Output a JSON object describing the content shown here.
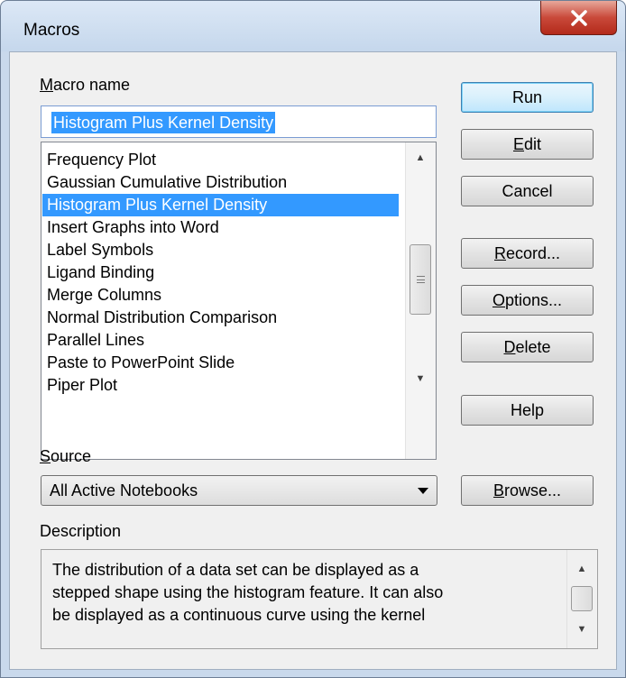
{
  "window": {
    "title": "Macros"
  },
  "macro_name": {
    "label_prefix": "",
    "label_mnemonic": "M",
    "label_rest": "acro name",
    "value": "Histogram Plus Kernel Density"
  },
  "macro_list": {
    "items": [
      "Frequency Plot",
      "Gaussian Cumulative Distribution",
      "Histogram Plus Kernel Density",
      "Insert Graphs into Word",
      "Label Symbols",
      "Ligand Binding",
      "Merge Columns",
      "Normal Distribution Comparison",
      "Parallel Lines",
      "Paste to PowerPoint Slide",
      "Piper Plot"
    ],
    "selected_index": 2
  },
  "buttons": {
    "run": "Run",
    "edit_mn": "E",
    "edit_rest": "dit",
    "cancel": "Cancel",
    "record_mn": "R",
    "record_rest": "ecord...",
    "options_mn": "O",
    "options_rest": "ptions...",
    "delete_mn": "D",
    "delete_rest": "elete",
    "help": "Help",
    "browse_mn": "B",
    "browse_rest": "rowse..."
  },
  "source": {
    "label_mn": "S",
    "label_rest": "ource",
    "value": "All Active Notebooks"
  },
  "description": {
    "label": "Description",
    "lines": [
      "The distribution of a data set can be displayed as a",
      "stepped shape using the histogram feature.  It can also",
      "be displayed as a continuous curve using the kernel"
    ]
  },
  "colors": {
    "selection": "#3399ff",
    "close_button": "#c9493a"
  }
}
